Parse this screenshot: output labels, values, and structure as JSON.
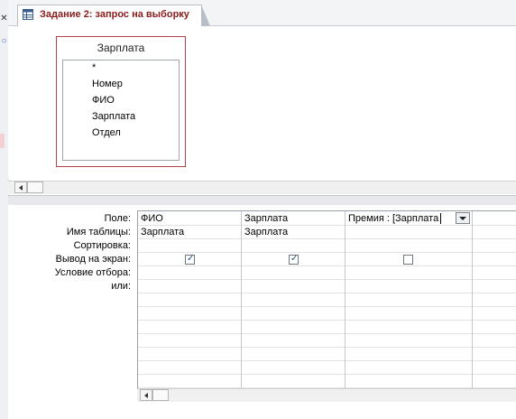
{
  "tab": {
    "title": "Задание 2: запрос на выборку",
    "icon": "query-icon"
  },
  "left_strip": {
    "icons": [
      "close-icon",
      "search-icon"
    ]
  },
  "table_field_list": {
    "title": "Зарплата",
    "fields": [
      "*",
      "Номер",
      "ФИО",
      "Зарплата",
      "Отдел"
    ]
  },
  "grid": {
    "row_labels": [
      "Поле:",
      "Имя таблицы:",
      "Сортировка:",
      "Вывод на экран:",
      "Условие отбора:",
      "или:"
    ],
    "columns": [
      {
        "field": "ФИО",
        "table": "Зарплата",
        "sort": "",
        "show": true,
        "criteria": "",
        "or": ""
      },
      {
        "field": "Зарплата",
        "table": "Зарплата",
        "sort": "",
        "show": true,
        "criteria": "",
        "or": ""
      },
      {
        "field": "Премия : [Зарплата",
        "table": "",
        "sort": "",
        "show": false,
        "criteria": "",
        "or": "",
        "has_dropdown": true
      }
    ]
  },
  "colors": {
    "tab_title": "#8a1c1c",
    "field_list_border": "#b0424b",
    "checkbox_tick": "#1d4f8c"
  }
}
